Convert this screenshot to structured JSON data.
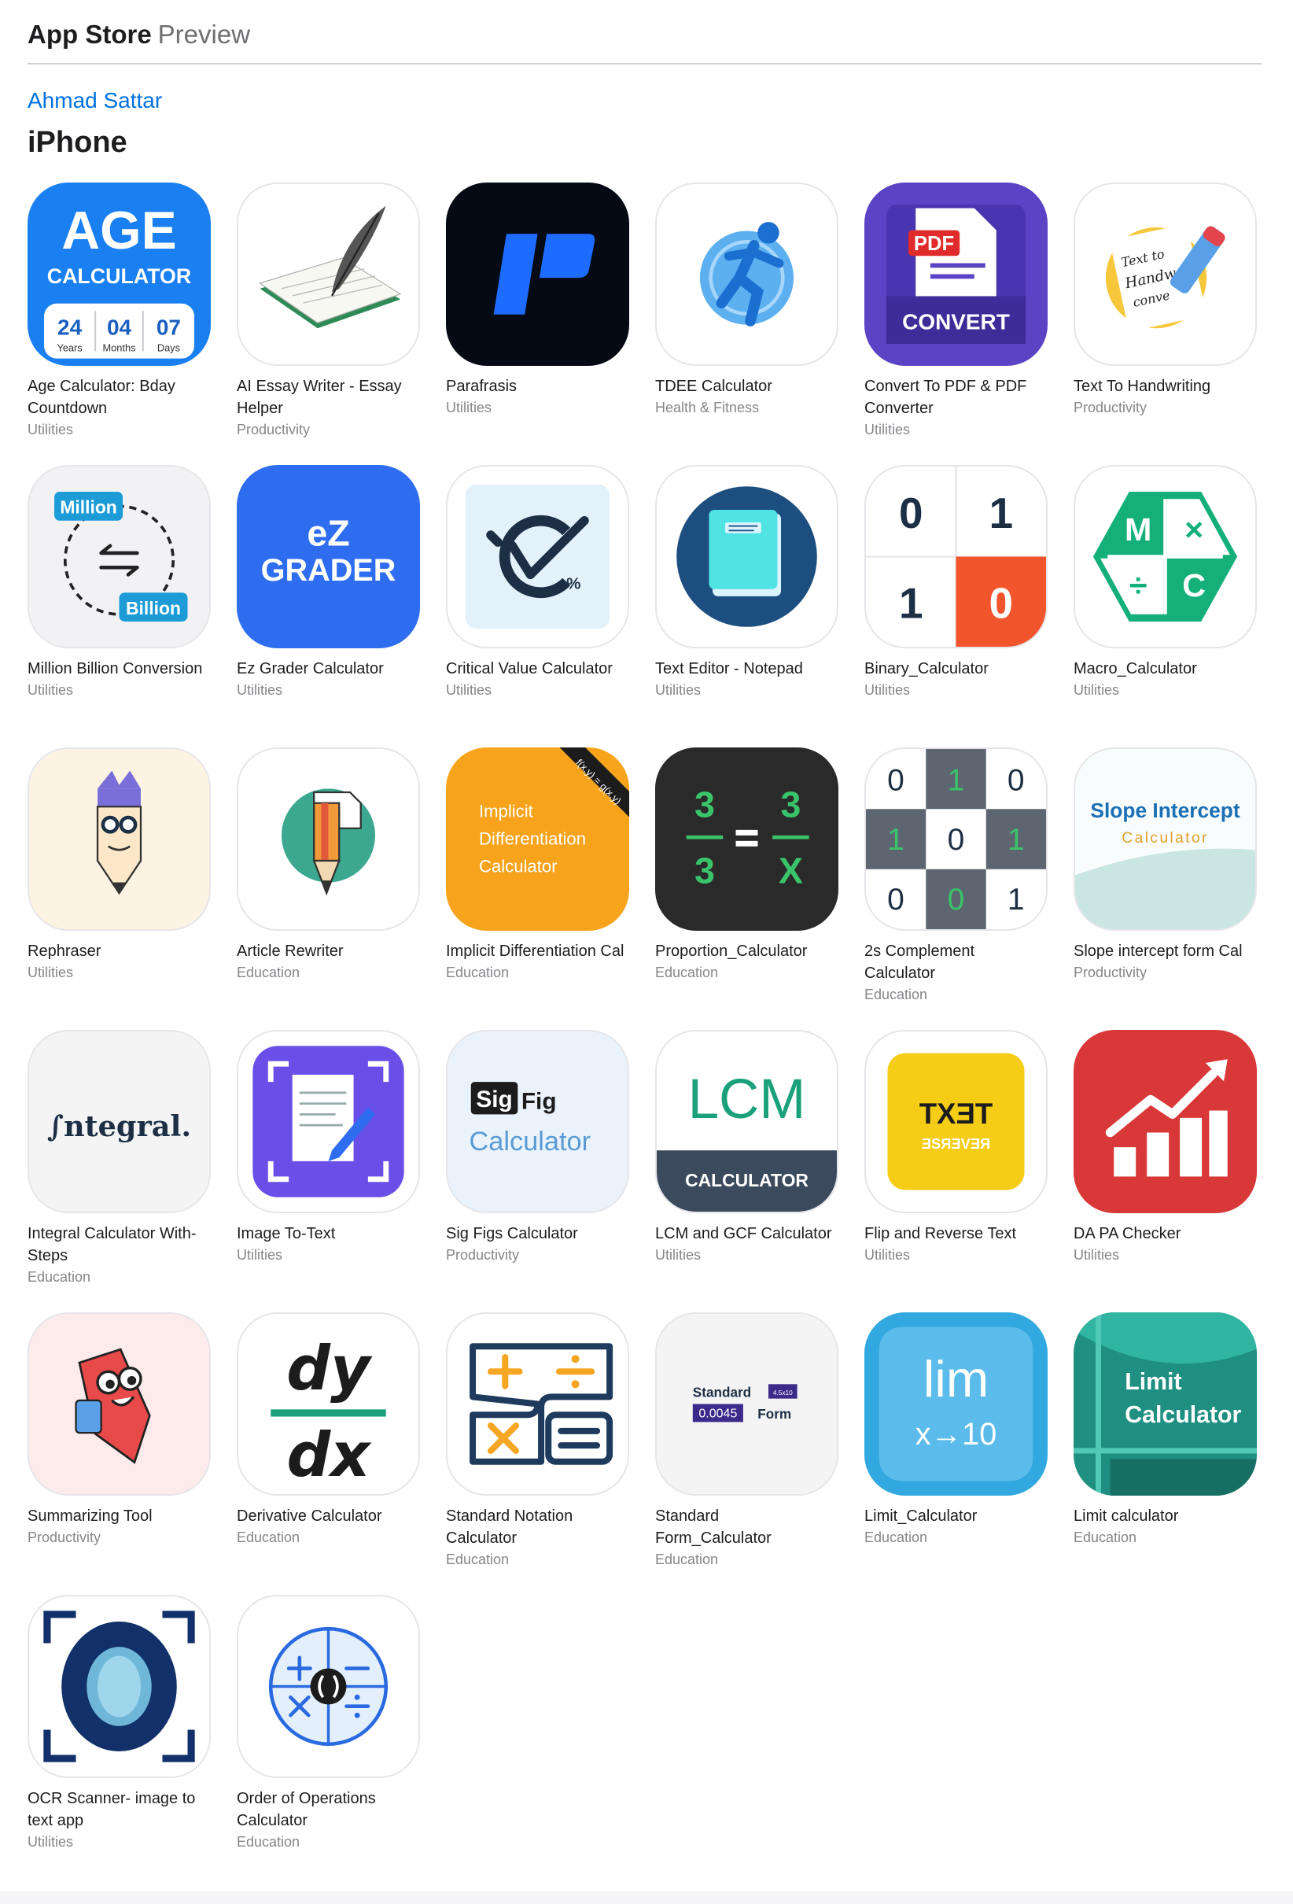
{
  "header": {
    "brand": "App Store",
    "sub": "Preview"
  },
  "developer": {
    "name": "Ahmad Sattar"
  },
  "platform": "iPhone",
  "apps": [
    {
      "name": "Age Calculator: Bday Countdown",
      "category": "Utilities",
      "icon": "age-calculator-icon"
    },
    {
      "name": "AI Essay Writer - Essay Helper",
      "category": "Productivity",
      "icon": "quill-notebook-icon"
    },
    {
      "name": "Parafrasis",
      "category": "Utilities",
      "icon": "parafrasis-logo-icon"
    },
    {
      "name": "TDEE Calculator",
      "category": "Health & Fitness",
      "icon": "running-person-icon"
    },
    {
      "name": "Convert To PDF & PDF Converter",
      "category": "Utilities",
      "icon": "pdf-convert-icon"
    },
    {
      "name": "Text To Handwriting",
      "category": "Productivity",
      "icon": "handwriting-pen-icon"
    },
    {
      "name": "Million Billion Conversion",
      "category": "Utilities",
      "icon": "million-billion-icon"
    },
    {
      "name": "Ez Grader Calculator",
      "category": "Utilities",
      "icon": "ez-grader-icon"
    },
    {
      "name": "Critical Value Calculator",
      "category": "Utilities",
      "icon": "critical-value-icon"
    },
    {
      "name": "Text Editor - Notepad",
      "category": "Utilities",
      "icon": "notepad-book-icon"
    },
    {
      "name": "Binary_Calculator",
      "category": "Utilities",
      "icon": "binary-digits-icon"
    },
    {
      "name": "Macro_Calculator",
      "category": "Utilities",
      "icon": "macro-hexagon-icon"
    },
    {
      "name": "Rephraser",
      "category": "Utilities",
      "icon": "pencil-character-icon"
    },
    {
      "name": "Article Rewriter",
      "category": "Education",
      "icon": "pencil-paper-icon"
    },
    {
      "name": "Implicit Differentiation Cal",
      "category": "Education",
      "icon": "implicit-differentiation-icon"
    },
    {
      "name": "Proportion_Calculator",
      "category": "Education",
      "icon": "proportion-icon"
    },
    {
      "name": "2s Complement Calculator",
      "category": "Education",
      "icon": "twos-complement-grid-icon"
    },
    {
      "name": "Slope intercept form Cal",
      "category": "Productivity",
      "icon": "slope-intercept-icon"
    },
    {
      "name": "Integral Calculator With-Steps",
      "category": "Education",
      "icon": "integral-logo-icon"
    },
    {
      "name": "Image To-Text",
      "category": "Utilities",
      "icon": "scan-document-icon"
    },
    {
      "name": "Sig Figs Calculator",
      "category": "Productivity",
      "icon": "sig-fig-icon"
    },
    {
      "name": "LCM and GCF Calculator",
      "category": "Utilities",
      "icon": "lcm-calculator-icon"
    },
    {
      "name": "Flip and Reverse Text",
      "category": "Utilities",
      "icon": "flip-text-icon"
    },
    {
      "name": "DA PA Checker",
      "category": "Utilities",
      "icon": "growth-chart-icon"
    },
    {
      "name": "Summarizing Tool",
      "category": "Productivity",
      "icon": "pencil-mascot-icon"
    },
    {
      "name": "Derivative Calculator",
      "category": "Education",
      "icon": "dy-dx-icon"
    },
    {
      "name": "Standard Notation Calculator",
      "category": "Education",
      "icon": "operators-grid-icon"
    },
    {
      "name": "Standard Form_Calculator",
      "category": "Education",
      "icon": "standard-form-icon"
    },
    {
      "name": "Limit_Calculator",
      "category": "Education",
      "icon": "limit-expression-icon"
    },
    {
      "name": "Limit calculator",
      "category": "Education",
      "icon": "limit-calculator-icon"
    },
    {
      "name": "OCR Scanner- image to text app",
      "category": "Utilities",
      "icon": "ocr-scanner-icon"
    },
    {
      "name": "Order of Operations Calculator",
      "category": "Education",
      "icon": "operations-circle-icon"
    }
  ],
  "icon_text": {
    "age": {
      "title": "AGE",
      "sub": "CALCULATOR",
      "d1": "24",
      "d2": "04",
      "d3": "07",
      "l1": "Years",
      "l2": "Months",
      "l3": "Days"
    },
    "pdf": {
      "badge": "PDF",
      "label": "CONVERT"
    },
    "handwriting": {
      "l1": "Text to",
      "l2": "Handw",
      "l3": "conve"
    },
    "millionbillion": {
      "top": "Million",
      "bottom": "Billion"
    },
    "ezgrader": {
      "line1": "eZ",
      "line2": "GRADER"
    },
    "critical": {
      "pct": "%"
    },
    "binary": {
      "a": "0",
      "b": "1",
      "c": "1",
      "d": "0"
    },
    "macro": {
      "a": "M",
      "b": "×",
      "c": "÷",
      "d": "C"
    },
    "implicit": {
      "l1": "Implicit",
      "l2": "Differentiation",
      "l3": "Calculator",
      "band": "f(x,y) = g(x,y)"
    },
    "proportion": {
      "a": "3",
      "b": "3",
      "c": "3",
      "d": "X"
    },
    "twos": {
      "cells": [
        "0",
        "1",
        "0",
        "1",
        "0",
        "1",
        "0",
        "0",
        "1"
      ]
    },
    "slope": {
      "l1": "Slope Intercept",
      "l2": "Calculator"
    },
    "integral": {
      "text": "∫ntegral."
    },
    "sigfig": {
      "sig": "Sig",
      "fig": "Fig",
      "calc": "Calculator"
    },
    "lcm": {
      "big": "LCM",
      "label": "CALCULATOR"
    },
    "flip": {
      "top": "TXƎT",
      "bottom": "ƎSЯƎVƎЯ"
    },
    "dydx": {
      "top": "dy",
      "bottom": "dx"
    },
    "standardform": {
      "l1": "Standard",
      "exp": "4.5x10",
      "l2": "0.0045",
      "l3": "Form"
    },
    "limit": {
      "l1": "lim",
      "l2": "x→10"
    },
    "limitcalc": {
      "l1": "Limit",
      "l2": "Calculator"
    }
  },
  "colors": {
    "accent": "#0071e3",
    "age_blue": "#1a7ff0",
    "pdf_purple": "#5b43c6",
    "ezgrader_blue": "#2f6df0",
    "implicit_orange": "#f8a31c",
    "dapa_red": "#d93838",
    "flip_yellow": "#f5cc16",
    "limit_teal": "#1e8f80"
  }
}
